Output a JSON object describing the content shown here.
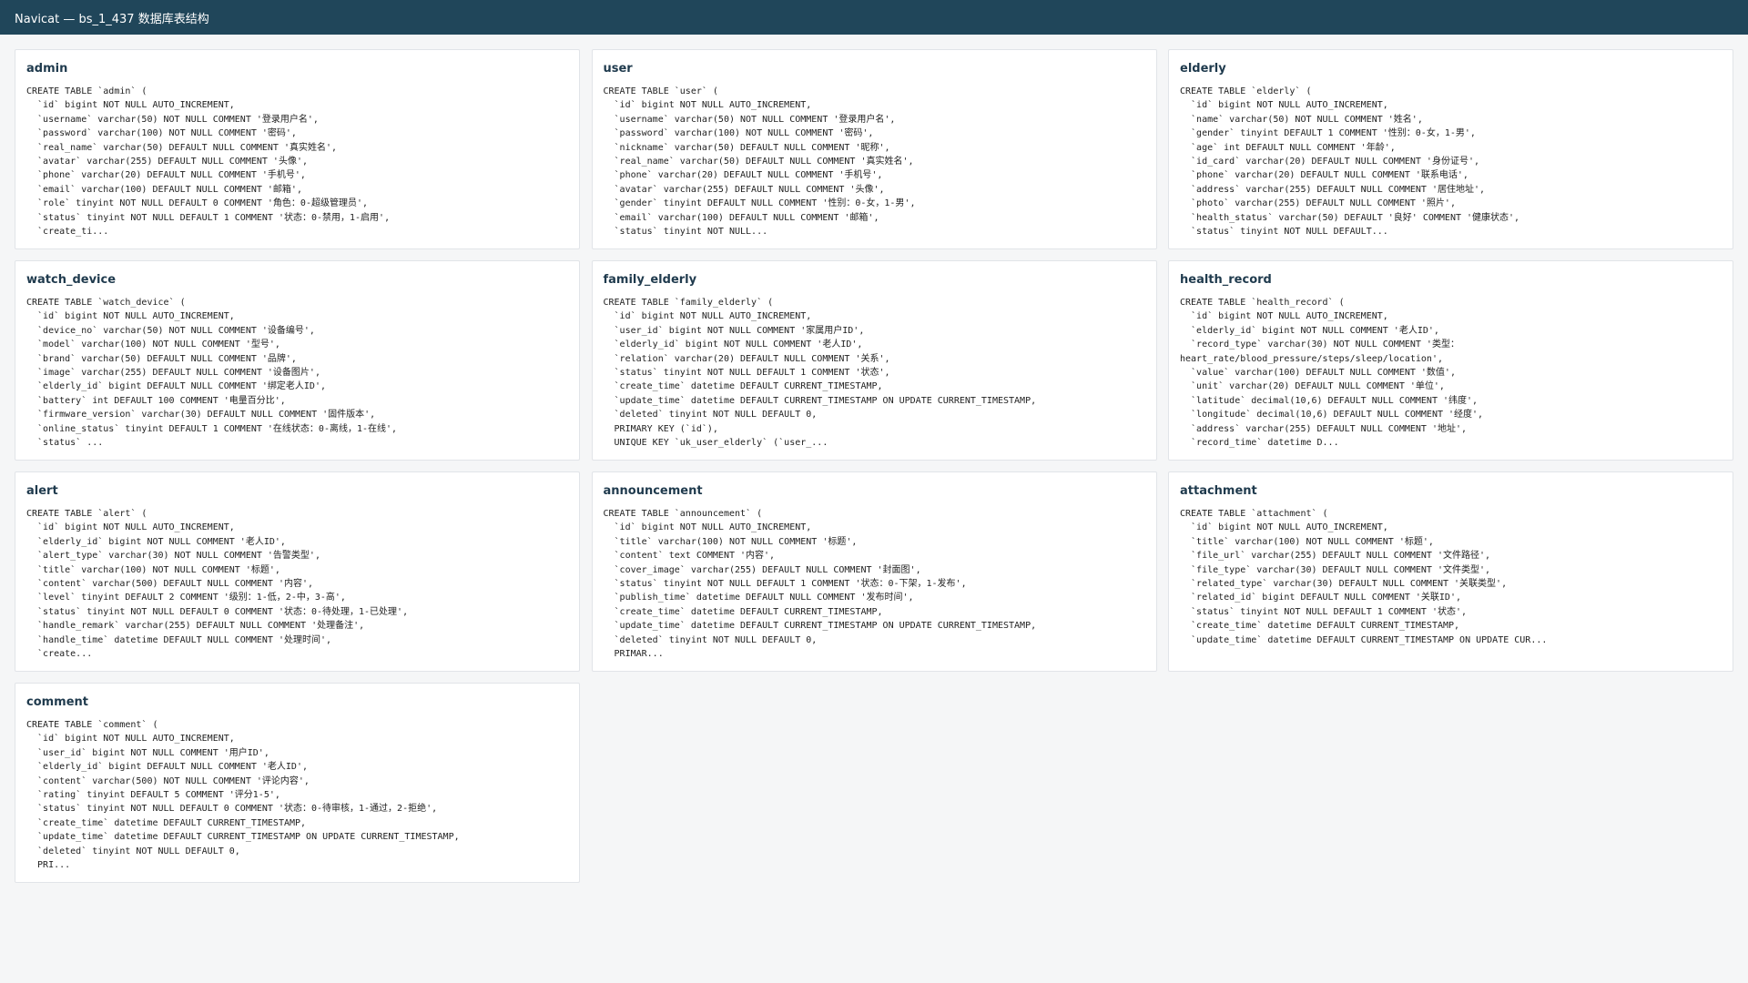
{
  "window": {
    "title": "Navicat — bs_1_437 数据库表结构"
  },
  "tables": [
    {
      "name": "admin",
      "sql": "CREATE TABLE `admin` (\n  `id` bigint NOT NULL AUTO_INCREMENT,\n  `username` varchar(50) NOT NULL COMMENT '登录用户名',\n  `password` varchar(100) NOT NULL COMMENT '密码',\n  `real_name` varchar(50) DEFAULT NULL COMMENT '真实姓名',\n  `avatar` varchar(255) DEFAULT NULL COMMENT '头像',\n  `phone` varchar(20) DEFAULT NULL COMMENT '手机号',\n  `email` varchar(100) DEFAULT NULL COMMENT '邮箱',\n  `role` tinyint NOT NULL DEFAULT 0 COMMENT '角色：0-超级管理员',\n  `status` tinyint NOT NULL DEFAULT 1 COMMENT '状态：0-禁用，1-启用',\n  `create_ti..."
    },
    {
      "name": "user",
      "sql": "CREATE TABLE `user` (\n  `id` bigint NOT NULL AUTO_INCREMENT,\n  `username` varchar(50) NOT NULL COMMENT '登录用户名',\n  `password` varchar(100) NOT NULL COMMENT '密码',\n  `nickname` varchar(50) DEFAULT NULL COMMENT '昵称',\n  `real_name` varchar(50) DEFAULT NULL COMMENT '真实姓名',\n  `phone` varchar(20) DEFAULT NULL COMMENT '手机号',\n  `avatar` varchar(255) DEFAULT NULL COMMENT '头像',\n  `gender` tinyint DEFAULT NULL COMMENT '性别：0-女，1-男',\n  `email` varchar(100) DEFAULT NULL COMMENT '邮箱',\n  `status` tinyint NOT NULL..."
    },
    {
      "name": "elderly",
      "sql": "CREATE TABLE `elderly` (\n  `id` bigint NOT NULL AUTO_INCREMENT,\n  `name` varchar(50) NOT NULL COMMENT '姓名',\n  `gender` tinyint DEFAULT 1 COMMENT '性别：0-女，1-男',\n  `age` int DEFAULT NULL COMMENT '年龄',\n  `id_card` varchar(20) DEFAULT NULL COMMENT '身份证号',\n  `phone` varchar(20) DEFAULT NULL COMMENT '联系电话',\n  `address` varchar(255) DEFAULT NULL COMMENT '居住地址',\n  `photo` varchar(255) DEFAULT NULL COMMENT '照片',\n  `health_status` varchar(50) DEFAULT '良好' COMMENT '健康状态',\n  `status` tinyint NOT NULL DEFAULT..."
    },
    {
      "name": "watch_device",
      "sql": "CREATE TABLE `watch_device` (\n  `id` bigint NOT NULL AUTO_INCREMENT,\n  `device_no` varchar(50) NOT NULL COMMENT '设备编号',\n  `model` varchar(100) NOT NULL COMMENT '型号',\n  `brand` varchar(50) DEFAULT NULL COMMENT '品牌',\n  `image` varchar(255) DEFAULT NULL COMMENT '设备图片',\n  `elderly_id` bigint DEFAULT NULL COMMENT '绑定老人ID',\n  `battery` int DEFAULT 100 COMMENT '电量百分比',\n  `firmware_version` varchar(30) DEFAULT NULL COMMENT '固件版本',\n  `online_status` tinyint DEFAULT 1 COMMENT '在线状态：0-离线，1-在线',\n  `status` ..."
    },
    {
      "name": "family_elderly",
      "sql": "CREATE TABLE `family_elderly` (\n  `id` bigint NOT NULL AUTO_INCREMENT,\n  `user_id` bigint NOT NULL COMMENT '家属用户ID',\n  `elderly_id` bigint NOT NULL COMMENT '老人ID',\n  `relation` varchar(20) DEFAULT NULL COMMENT '关系',\n  `status` tinyint NOT NULL DEFAULT 1 COMMENT '状态',\n  `create_time` datetime DEFAULT CURRENT_TIMESTAMP,\n  `update_time` datetime DEFAULT CURRENT_TIMESTAMP ON UPDATE CURRENT_TIMESTAMP,\n  `deleted` tinyint NOT NULL DEFAULT 0,\n  PRIMARY KEY (`id`),\n  UNIQUE KEY `uk_user_elderly` (`user_..."
    },
    {
      "name": "health_record",
      "sql": "CREATE TABLE `health_record` (\n  `id` bigint NOT NULL AUTO_INCREMENT,\n  `elderly_id` bigint NOT NULL COMMENT '老人ID',\n  `record_type` varchar(30) NOT NULL COMMENT '类型：\nheart_rate/blood_pressure/steps/sleep/location',\n  `value` varchar(100) DEFAULT NULL COMMENT '数值',\n  `unit` varchar(20) DEFAULT NULL COMMENT '单位',\n  `latitude` decimal(10,6) DEFAULT NULL COMMENT '纬度',\n  `longitude` decimal(10,6) DEFAULT NULL COMMENT '经度',\n  `address` varchar(255) DEFAULT NULL COMMENT '地址',\n  `record_time` datetime D..."
    },
    {
      "name": "alert",
      "sql": "CREATE TABLE `alert` (\n  `id` bigint NOT NULL AUTO_INCREMENT,\n  `elderly_id` bigint NOT NULL COMMENT '老人ID',\n  `alert_type` varchar(30) NOT NULL COMMENT '告警类型',\n  `title` varchar(100) NOT NULL COMMENT '标题',\n  `content` varchar(500) DEFAULT NULL COMMENT '内容',\n  `level` tinyint DEFAULT 2 COMMENT '级别：1-低，2-中，3-高',\n  `status` tinyint NOT NULL DEFAULT 0 COMMENT '状态：0-待处理，1-已处理',\n  `handle_remark` varchar(255) DEFAULT NULL COMMENT '处理备注',\n  `handle_time` datetime DEFAULT NULL COMMENT '处理时间',\n  `create..."
    },
    {
      "name": "announcement",
      "sql": "CREATE TABLE `announcement` (\n  `id` bigint NOT NULL AUTO_INCREMENT,\n  `title` varchar(100) NOT NULL COMMENT '标题',\n  `content` text COMMENT '内容',\n  `cover_image` varchar(255) DEFAULT NULL COMMENT '封面图',\n  `status` tinyint NOT NULL DEFAULT 1 COMMENT '状态：0-下架，1-发布',\n  `publish_time` datetime DEFAULT NULL COMMENT '发布时间',\n  `create_time` datetime DEFAULT CURRENT_TIMESTAMP,\n  `update_time` datetime DEFAULT CURRENT_TIMESTAMP ON UPDATE CURRENT_TIMESTAMP,\n  `deleted` tinyint NOT NULL DEFAULT 0,\n  PRIMAR..."
    },
    {
      "name": "attachment",
      "sql": "CREATE TABLE `attachment` (\n  `id` bigint NOT NULL AUTO_INCREMENT,\n  `title` varchar(100) NOT NULL COMMENT '标题',\n  `file_url` varchar(255) DEFAULT NULL COMMENT '文件路径',\n  `file_type` varchar(30) DEFAULT NULL COMMENT '文件类型',\n  `related_type` varchar(30) DEFAULT NULL COMMENT '关联类型',\n  `related_id` bigint DEFAULT NULL COMMENT '关联ID',\n  `status` tinyint NOT NULL DEFAULT 1 COMMENT '状态',\n  `create_time` datetime DEFAULT CURRENT_TIMESTAMP,\n  `update_time` datetime DEFAULT CURRENT_TIMESTAMP ON UPDATE CUR..."
    },
    {
      "name": "comment",
      "sql": "CREATE TABLE `comment` (\n  `id` bigint NOT NULL AUTO_INCREMENT,\n  `user_id` bigint NOT NULL COMMENT '用户ID',\n  `elderly_id` bigint DEFAULT NULL COMMENT '老人ID',\n  `content` varchar(500) NOT NULL COMMENT '评论内容',\n  `rating` tinyint DEFAULT 5 COMMENT '评分1-5',\n  `status` tinyint NOT NULL DEFAULT 0 COMMENT '状态：0-待审核，1-通过，2-拒绝',\n  `create_time` datetime DEFAULT CURRENT_TIMESTAMP,\n  `update_time` datetime DEFAULT CURRENT_TIMESTAMP ON UPDATE CURRENT_TIMESTAMP,\n  `deleted` tinyint NOT NULL DEFAULT 0,\n  PRI..."
    }
  ]
}
